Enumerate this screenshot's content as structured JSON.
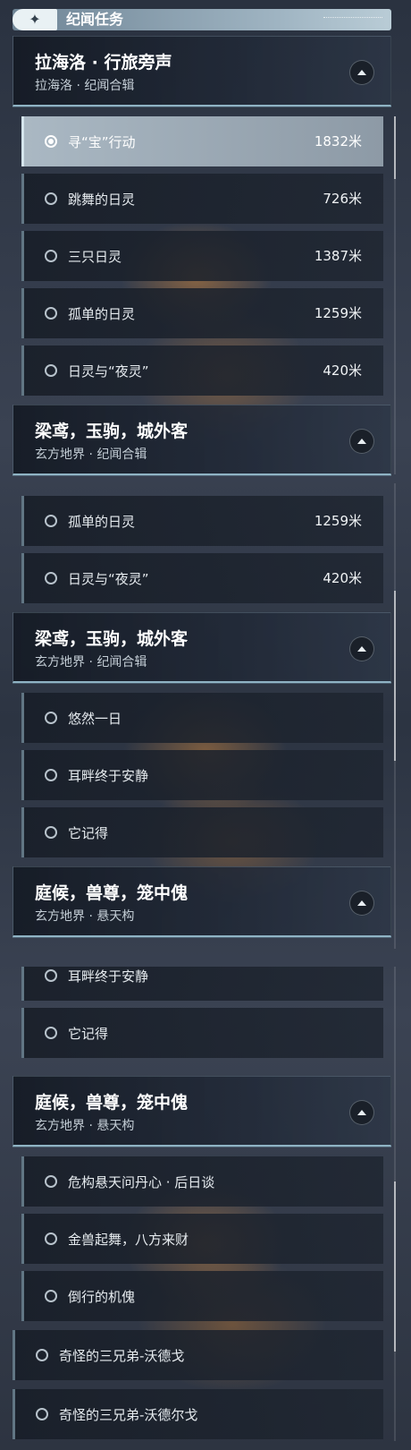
{
  "topbar": {
    "icon": "sparkle-icon",
    "title": "纪闻任务"
  },
  "sections": [
    {
      "groups": [
        {
          "title": "拉海洛 · 行旅旁声",
          "subtitle": "拉海洛 · 纪闻合辑",
          "items": [
            {
              "label": "寻“宝”行动",
              "distance": "1832米",
              "selected": true
            },
            {
              "label": "跳舞的日灵",
              "distance": "726米"
            },
            {
              "label": "三只日灵",
              "distance": "1387米"
            },
            {
              "label": "孤单的日灵",
              "distance": "1259米"
            },
            {
              "label": "日灵与“夜灵”",
              "distance": "420米"
            }
          ]
        },
        {
          "title": "梁鸢，玉驹，城外客",
          "subtitle": "玄方地界 · 纪闻合辑",
          "items": []
        }
      ]
    },
    {
      "groups": [
        {
          "title": "",
          "subtitle": "",
          "items": [
            {
              "label": "孤单的日灵",
              "distance": "1259米"
            },
            {
              "label": "日灵与“夜灵”",
              "distance": "420米"
            }
          ]
        },
        {
          "title": "梁鸢，玉驹，城外客",
          "subtitle": "玄方地界 · 纪闻合辑",
          "items": [
            {
              "label": "悠然一日",
              "distance": ""
            },
            {
              "label": "耳畔终于安静",
              "distance": ""
            },
            {
              "label": "它记得",
              "distance": ""
            }
          ]
        },
        {
          "title": "庭候，兽尊，笼中傀",
          "subtitle": "玄方地界 · 悬天构",
          "items": []
        }
      ]
    },
    {
      "groups": [
        {
          "title": "",
          "subtitle": "",
          "items": [
            {
              "label": "耳畔终于安静",
              "distance": ""
            },
            {
              "label": "它记得",
              "distance": ""
            }
          ]
        },
        {
          "title": "庭候，兽尊，笼中傀",
          "subtitle": "玄方地界 · 悬天构",
          "items": [
            {
              "label": "危构悬天问丹心 · 后日谈",
              "distance": ""
            },
            {
              "label": "金兽起舞，八方来财",
              "distance": ""
            },
            {
              "label": "倒行的机傀",
              "distance": ""
            },
            {
              "label": "奇怪的三兄弟-沃德戈",
              "distance": ""
            },
            {
              "label": "奇怪的三兄弟-沃德尔戈",
              "distance": ""
            }
          ]
        }
      ]
    }
  ]
}
